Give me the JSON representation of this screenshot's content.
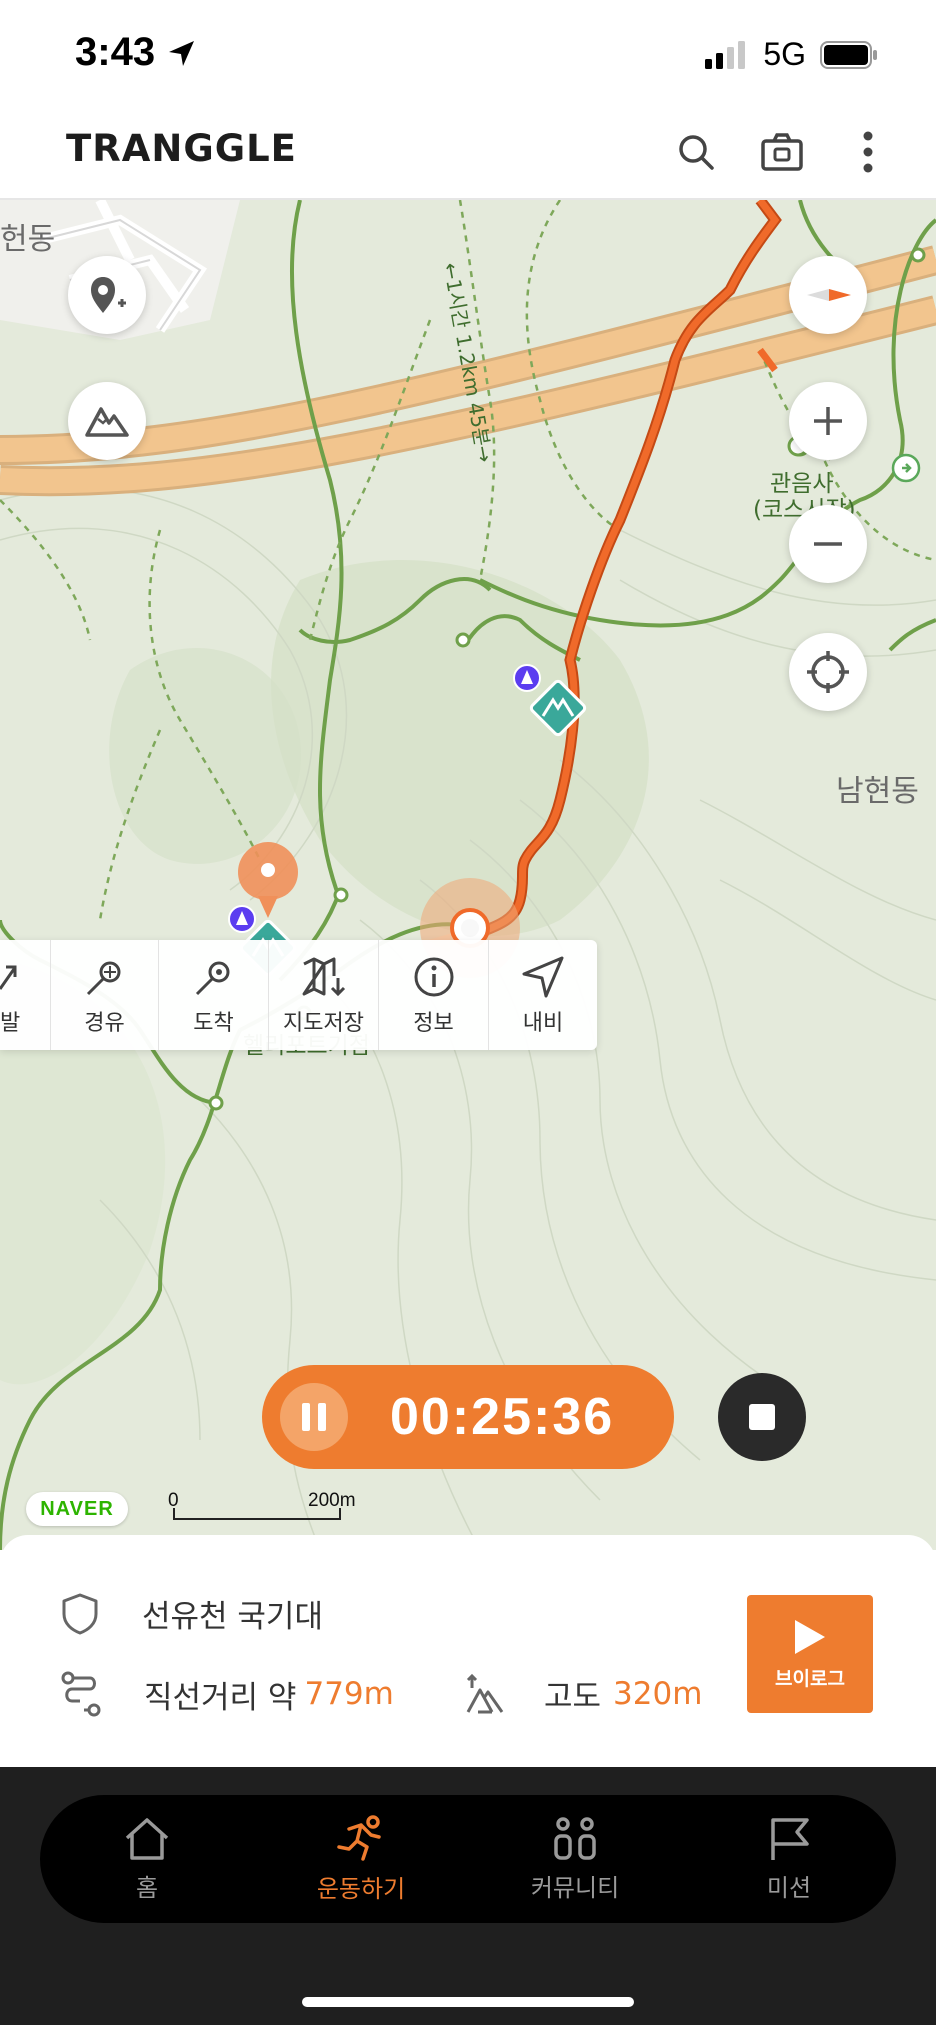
{
  "status_bar": {
    "time": "3:43",
    "network": "5G"
  },
  "header": {
    "logo": "TRANGGLE"
  },
  "map": {
    "labels": {
      "top_left": "헌동",
      "trail_note": "←1시간 1.2km 45분→",
      "temple": "관음사",
      "temple_sub": "(코스시작)",
      "namhyeon": "남현동",
      "heliport": "헬리포트기점"
    },
    "naver": "NAVER",
    "scale": {
      "zero": "0",
      "distance": "200m"
    }
  },
  "route_menu": {
    "items": [
      {
        "label": "발",
        "icon": "start-arrow-icon"
      },
      {
        "label": "경유",
        "icon": "waypoint-icon"
      },
      {
        "label": "도착",
        "icon": "arrival-icon"
      },
      {
        "label": "지도저장",
        "icon": "map-download-icon"
      },
      {
        "label": "정보",
        "icon": "info-icon"
      },
      {
        "label": "내비",
        "icon": "navigation-icon"
      }
    ]
  },
  "timer": {
    "elapsed": "00:25:36"
  },
  "info": {
    "course_name": "선유천 국기대",
    "distance_label": "직선거리 약",
    "distance_value": "779m",
    "altitude_label": "고도",
    "altitude_value": "320m",
    "vlog_label": "브이로그"
  },
  "bottom_nav": {
    "items": [
      {
        "label": "홈",
        "active": false
      },
      {
        "label": "운동하기",
        "active": true
      },
      {
        "label": "커뮤니티",
        "active": false
      },
      {
        "label": "미션",
        "active": false
      }
    ]
  },
  "colors": {
    "accent": "#ee7c2f",
    "route": "#f06a2a",
    "trail": "#6fa04a",
    "road": "#f2c58e"
  }
}
